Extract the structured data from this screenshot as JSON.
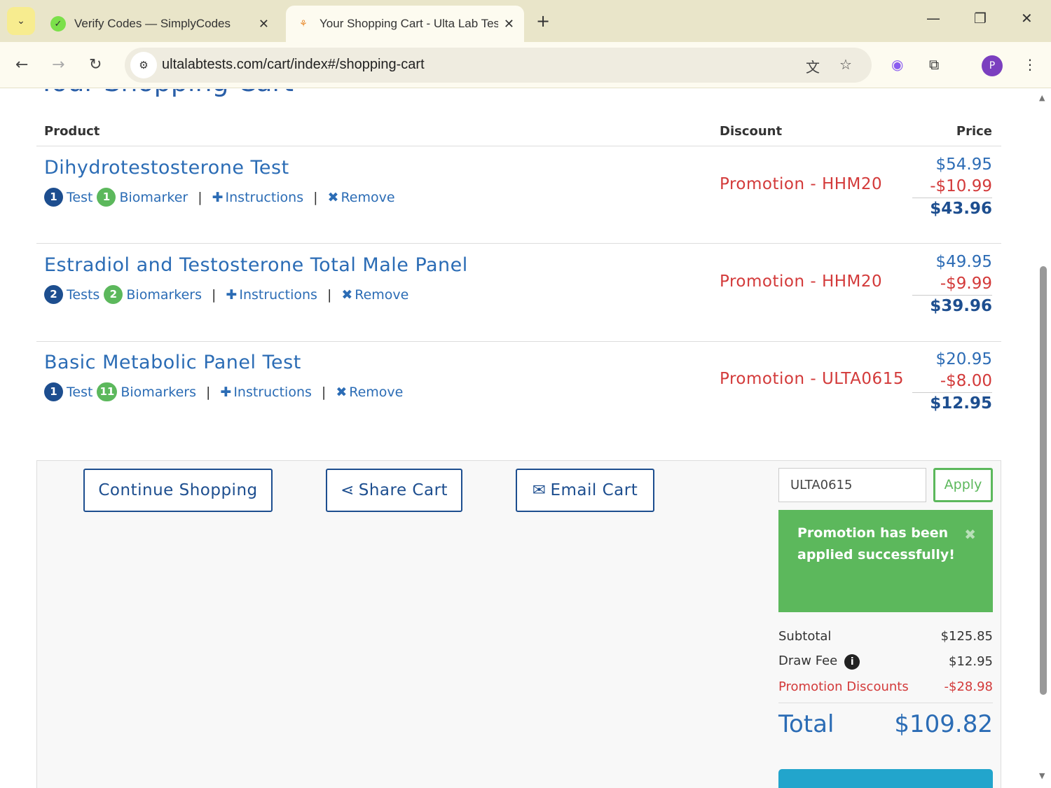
{
  "browser": {
    "tabs": [
      {
        "title": "Verify Codes — SimplyCodes",
        "icon": "simplycodes-icon"
      },
      {
        "title": "Your Shopping Cart - Ulta Lab Tests",
        "icon": "ulta-icon"
      }
    ],
    "url": "ultalabtests.com/cart/index#/shopping-cart",
    "profile": "P"
  },
  "page": {
    "title": "Your Shopping Cart",
    "headers": {
      "product": "Product",
      "discount": "Discount",
      "price": "Price"
    },
    "items": [
      {
        "name": "Dihydrotestosterone Test",
        "tests": "1",
        "tests_label": "Test",
        "biomarkers": "1",
        "biomarkers_label": "Biomarker",
        "instructions": "Instructions",
        "remove": "Remove",
        "promo": "Promotion - HHM20",
        "price": "$54.95",
        "discount": "-$10.99",
        "final": "$43.96"
      },
      {
        "name": "Estradiol and Testosterone Total Male Panel",
        "tests": "2",
        "tests_label": "Tests",
        "biomarkers": "2",
        "biomarkers_label": "Biomarkers",
        "instructions": "Instructions",
        "remove": "Remove",
        "promo": "Promotion - HHM20",
        "price": "$49.95",
        "discount": "-$9.99",
        "final": "$39.96"
      },
      {
        "name": "Basic Metabolic Panel Test",
        "tests": "1",
        "tests_label": "Test",
        "biomarkers": "11",
        "biomarkers_label": "Biomarkers",
        "instructions": "Instructions",
        "remove": "Remove",
        "promo": "Promotion - ULTA0615",
        "price": "$20.95",
        "discount": "-$8.00",
        "final": "$12.95"
      }
    ],
    "buttons": {
      "continue": "Continue Shopping",
      "share": "Share Cart",
      "email": "Email Cart",
      "apply": "Apply"
    },
    "promo_code": "ULTA0615",
    "alert": "Promotion has been applied successfully!",
    "summary": {
      "subtotal_label": "Subtotal",
      "subtotal": "$125.85",
      "draw_fee_label": "Draw Fee",
      "draw_fee": "$12.95",
      "promo_label": "Promotion Discounts",
      "promo": "-$28.98",
      "total_label": "Total",
      "total": "$109.82"
    }
  },
  "colors": {
    "brand": "#2b6cb5",
    "promo": "#d33a3a",
    "success": "#5cb85c"
  }
}
